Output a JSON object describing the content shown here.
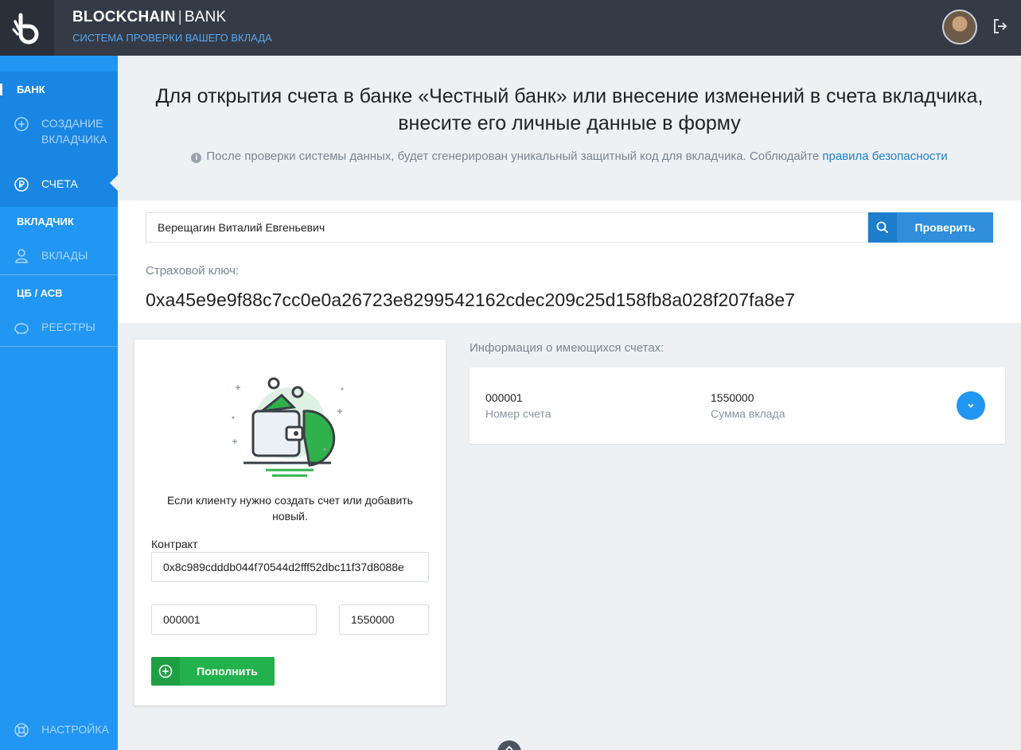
{
  "header": {
    "brand_bold": "BLOCKCHAIN",
    "brand_sep": "|",
    "brand_light": "BANK",
    "subtitle": "СИСТЕМА ПРОВЕРКИ ВАШЕГО ВКЛАДА"
  },
  "sidebar": {
    "sections": [
      {
        "title": "БАНК",
        "items": [
          {
            "label": "СОЗДАНИЕ ВКЛАДЧИКА",
            "icon": "plus-circle-icon"
          },
          {
            "label": "СЧЕТА",
            "icon": "ruble-refresh-icon",
            "active": true
          }
        ]
      },
      {
        "title": "ВКЛАДЧИК",
        "items": [
          {
            "label": "ВКЛАДЫ",
            "icon": "user-icon"
          }
        ]
      },
      {
        "title": "ЦБ / АСВ",
        "items": [
          {
            "label": "РЕЕСТРЫ",
            "icon": "piggy-bank-icon"
          }
        ]
      }
    ],
    "settings_label": "НАСТРОЙКА"
  },
  "intro": {
    "title_line1": "Для открытия счета в банке «Честный банк» или внесение изменений в счета вкладчика,",
    "title_line2": "внесите его личные данные в форму",
    "note": "После проверки системы данных, будет сгенерирован уникальный защитный код для вкладчика. Соблюдайте",
    "note_link": "правила безопасности"
  },
  "search": {
    "value": "Верещагин Виталий Евгеньевич",
    "button_label": "Проверить"
  },
  "insurance": {
    "label": "Страховой ключ:",
    "key": "0xa45e9e9f88c7cc0e0a26723e8299542162cdec209c25d158fb8a028f207fa8e7"
  },
  "new_account_card": {
    "text": "Если клиенту нужно создать счет или добавить новый.",
    "contract_label": "Контракт",
    "contract_value": "0x8c989cdddb044f70544d2fff52dbc11f37d8088e",
    "account_value": "000001",
    "amount_value": "1550000",
    "button_label": "Пополнить"
  },
  "accounts": {
    "title": "Информация о имеющихся счетах:",
    "rows": [
      {
        "number": "000001",
        "number_label": "Номер счета",
        "amount": "1550000",
        "amount_label": "Сумма вклада"
      }
    ]
  },
  "colors": {
    "topbar": "#343b46",
    "sidebar": "#2196f3",
    "primary_button": "#2f8ddc",
    "success_button": "#22b14c"
  }
}
